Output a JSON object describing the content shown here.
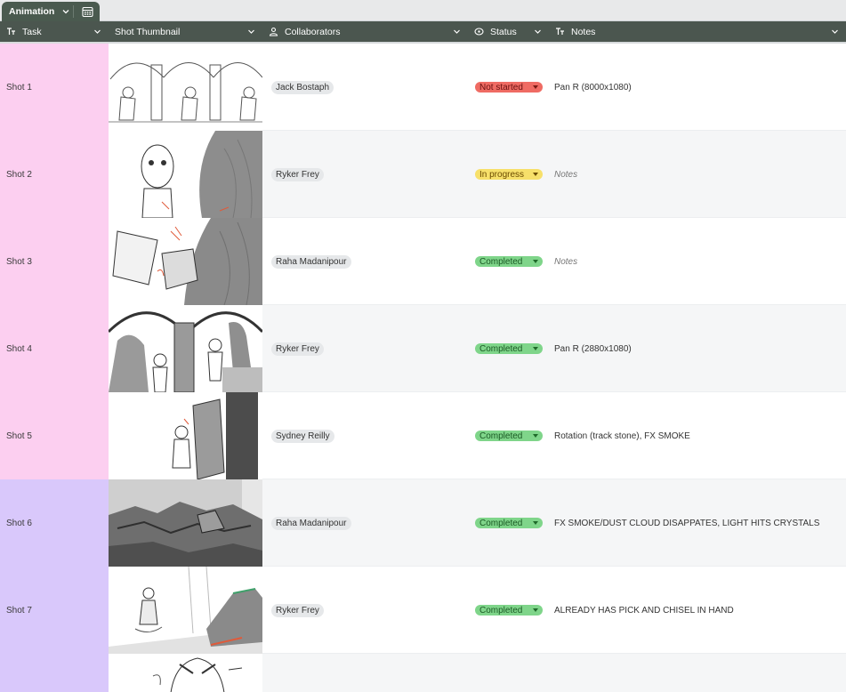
{
  "tab": {
    "label": "Animation"
  },
  "columns": [
    {
      "key": "task",
      "label": "Task",
      "icon": "text-type-icon"
    },
    {
      "key": "thumbnail",
      "label": "Shot Thumbnail",
      "icon": ""
    },
    {
      "key": "collaborators",
      "label": "Collaborators",
      "icon": "person-icon"
    },
    {
      "key": "status",
      "label": "Status",
      "icon": "status-icon"
    },
    {
      "key": "notes",
      "label": "Notes",
      "icon": "text-type-icon"
    }
  ],
  "rows": [
    {
      "task": "Shot 1",
      "collaborator": "Jack Bostaph",
      "status": "Not started",
      "status_color": "#ef6b63",
      "notes": "Pan R (8000x1080)",
      "notes_placeholder": false,
      "group_color": "#fccff0"
    },
    {
      "task": "Shot 2",
      "collaborator": "Ryker Frey",
      "status": "In progress",
      "status_color": "#f7e06a",
      "notes": "Notes",
      "notes_placeholder": true,
      "group_color": "#fccff0"
    },
    {
      "task": "Shot 3",
      "collaborator": "Raha Madanipour",
      "status": "Completed",
      "status_color": "#7fd58a",
      "notes": "Notes",
      "notes_placeholder": true,
      "group_color": "#fccff0"
    },
    {
      "task": "Shot 4",
      "collaborator": "Ryker Frey",
      "status": "Completed",
      "status_color": "#7fd58a",
      "notes": "Pan R (2880x1080)",
      "notes_placeholder": false,
      "group_color": "#fccff0"
    },
    {
      "task": "Shot 5",
      "collaborator": "Sydney Reilly",
      "status": "Completed",
      "status_color": "#7fd58a",
      "notes": "Rotation (track stone), FX SMOKE",
      "notes_placeholder": false,
      "group_color": "#fccff0"
    },
    {
      "task": "Shot 6",
      "collaborator": "Raha Madanipour",
      "status": "Completed",
      "status_color": "#7fd58a",
      "notes": "FX SMOKE/DUST CLOUD DISAPPATES, LIGHT HITS CRYSTALS",
      "notes_placeholder": false,
      "group_color": "#d9c8fb"
    },
    {
      "task": "Shot 7",
      "collaborator": "Ryker Frey",
      "status": "Completed",
      "status_color": "#7fd58a",
      "notes": "ALREADY HAS PICK AND CHISEL IN HAND",
      "notes_placeholder": false,
      "group_color": "#d9c8fb"
    }
  ],
  "colors": {
    "header_bg": "#4b564f",
    "tab_bg": "#4a5a4f",
    "pink_group": "#fccff0",
    "lavender_group": "#d9c8fb"
  }
}
